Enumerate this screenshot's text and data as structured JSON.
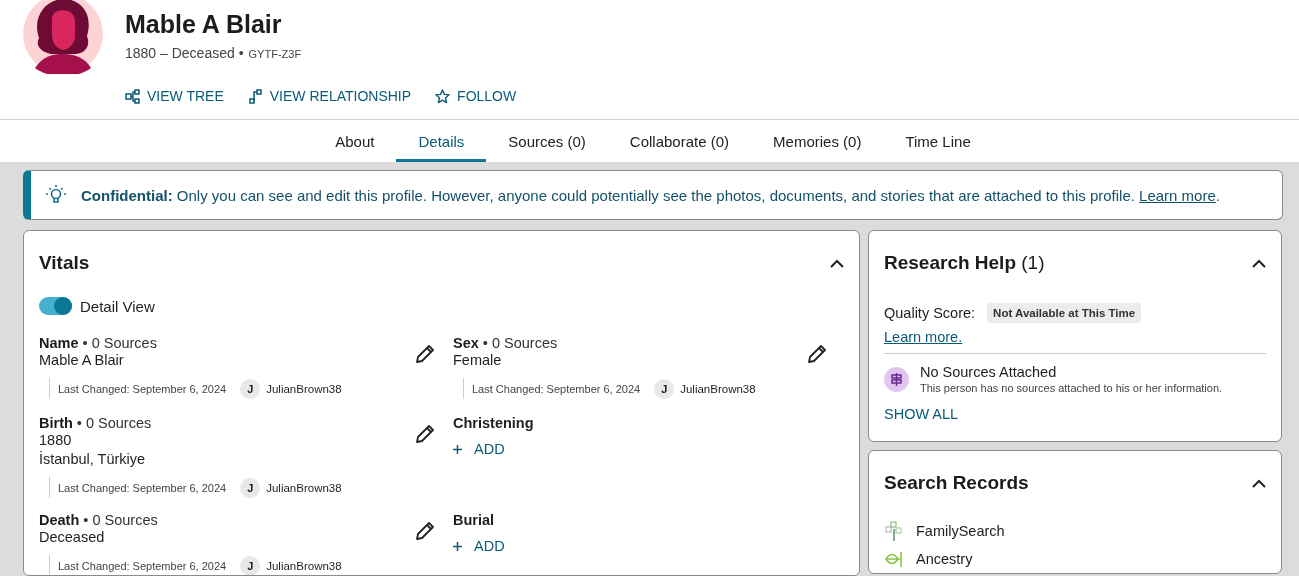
{
  "person": {
    "name": "Mable A Blair",
    "lifespan": "1880 – Deceased •",
    "pid": "GYTF-Z3F"
  },
  "actions": [
    {
      "kind": "tree",
      "label": "VIEW TREE"
    },
    {
      "kind": "relationship",
      "label": "VIEW RELATIONSHIP"
    },
    {
      "kind": "follow",
      "label": "FOLLOW"
    }
  ],
  "tabs": [
    {
      "label": "About",
      "selected": false
    },
    {
      "label": "Details",
      "selected": true
    },
    {
      "label": "Sources (0)",
      "selected": false
    },
    {
      "label": "Collaborate (0)",
      "selected": false
    },
    {
      "label": "Memories (0)",
      "selected": false
    },
    {
      "label": "Time Line",
      "selected": false
    }
  ],
  "banner": {
    "text": "**Confidential:** Only you can see and edit this profile. However, anyone could potentially see the photos, documents, and stories that are attached to this profile.",
    "link": "Learn more",
    "tail": "."
  },
  "vitals": {
    "title": "Vitals",
    "expanded": true,
    "toggle": {
      "label": "Detail View",
      "on": true
    },
    "facts": [
      {
        "kind": "fact",
        "heading": "**Name** • 0 Sources",
        "values": [
          "Mable A Blair"
        ],
        "changed": "Last Changed: September 6, 2024",
        "initial": "J",
        "user": "JulianBrown38"
      },
      {
        "kind": "fact",
        "heading": "**Sex** • 0 Sources",
        "values": [
          "Female"
        ],
        "changed": "Last Changed: September 6, 2024",
        "initial": "J",
        "user": "JulianBrown38"
      },
      {
        "kind": "fact",
        "heading": "**Birth** • 0 Sources",
        "values": [
          "1880",
          "İstanbul, Türkiye"
        ],
        "changed": "Last Changed: September 6, 2024",
        "initial": "J",
        "user": "JulianBrown38"
      },
      {
        "kind": "empty",
        "heading": "Christening",
        "add": "ADD"
      },
      {
        "kind": "fact",
        "heading": "**Death** • 0 Sources",
        "values": [
          "Deceased"
        ],
        "changed": "Last Changed: September 6, 2024",
        "initial": "J",
        "user": "JulianBrown38"
      },
      {
        "kind": "empty",
        "heading": "Burial",
        "add": "ADD"
      }
    ]
  },
  "research_help": {
    "title": "Research Help",
    "count": "(1)",
    "expanded": true,
    "quality_label": "Quality Score:",
    "quality_badge": "Not Available at This Time",
    "learn_more": "Learn more.",
    "items": [
      {
        "title": "No Sources Attached",
        "description": "This person has no sources attached to his or her information."
      }
    ],
    "show_all": "SHOW ALL"
  },
  "search_records": {
    "title": "Search Records",
    "expanded": true,
    "items": [
      {
        "kind": "familysearch",
        "label": "FamilySearch"
      },
      {
        "kind": "ancestry",
        "label": "Ancestry"
      }
    ]
  }
}
